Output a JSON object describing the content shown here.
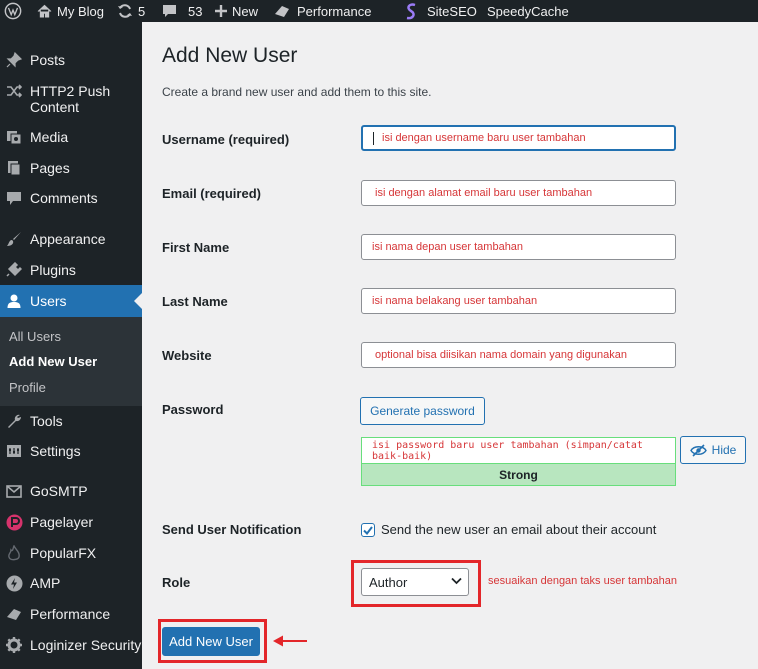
{
  "admin_bar": {
    "site_name": "My Blog",
    "updates_count": "5",
    "comments_count": "53",
    "new_label": "New",
    "performance_label": "Performance",
    "siteseo_label": "SiteSEO",
    "speedycache_label": "SpeedyCache"
  },
  "sidebar": {
    "items": [
      {
        "label": "Posts",
        "icon": "pin-icon"
      },
      {
        "label": "HTTP2 Push Content",
        "icon": "shuffle-icon"
      },
      {
        "label": "Media",
        "icon": "media-icon"
      },
      {
        "label": "Pages",
        "icon": "pages-icon"
      },
      {
        "label": "Comments",
        "icon": "comments-icon"
      },
      {
        "label": "Appearance",
        "icon": "brush-icon"
      },
      {
        "label": "Plugins",
        "icon": "plugin-icon"
      },
      {
        "label": "Users",
        "icon": "user-icon"
      },
      {
        "label": "Tools",
        "icon": "wrench-icon"
      },
      {
        "label": "Settings",
        "icon": "settings-icon"
      },
      {
        "label": "GoSMTP",
        "icon": "mail-icon"
      },
      {
        "label": "Pagelayer",
        "icon": "pagelayer-icon"
      },
      {
        "label": "PopularFX",
        "icon": "flame-icon"
      },
      {
        "label": "AMP",
        "icon": "amp-icon"
      },
      {
        "label": "Performance",
        "icon": "performance-icon"
      },
      {
        "label": "Loginizer Security",
        "icon": "gear-icon"
      }
    ],
    "submenu": [
      "All Users",
      "Add New User",
      "Profile"
    ]
  },
  "page": {
    "title": "Add New User",
    "description": "Create a brand new user and add them to this site."
  },
  "form": {
    "username_label": "Username (required)",
    "username_value": "isi dengan username baru user tambahan",
    "email_label": "Email (required)",
    "email_value": "isi dengan alamat email baru user tambahan",
    "first_name_label": "First Name",
    "first_name_value": "isi nama depan user tambahan",
    "last_name_label": "Last Name",
    "last_name_value": "isi nama belakang user tambahan",
    "website_label": "Website",
    "website_value": "optional bisa diisikan nama domain yang digunakan",
    "password_label": "Password",
    "generate_password_label": "Generate password",
    "password_value": "isi password baru user tambahan (simpan/catat baik-baik)",
    "hide_label": "Hide",
    "strength_label": "Strong",
    "notification_label": "Send User Notification",
    "notification_text": "Send the new user an email about their account",
    "role_label": "Role",
    "role_value": "Author",
    "role_note": "sesuaikan dengan taks user tambahan",
    "submit_label": "Add New User"
  },
  "colors": {
    "accent": "#2271b1",
    "annotation": "#e3262a",
    "strong": "#b8e6bf"
  }
}
